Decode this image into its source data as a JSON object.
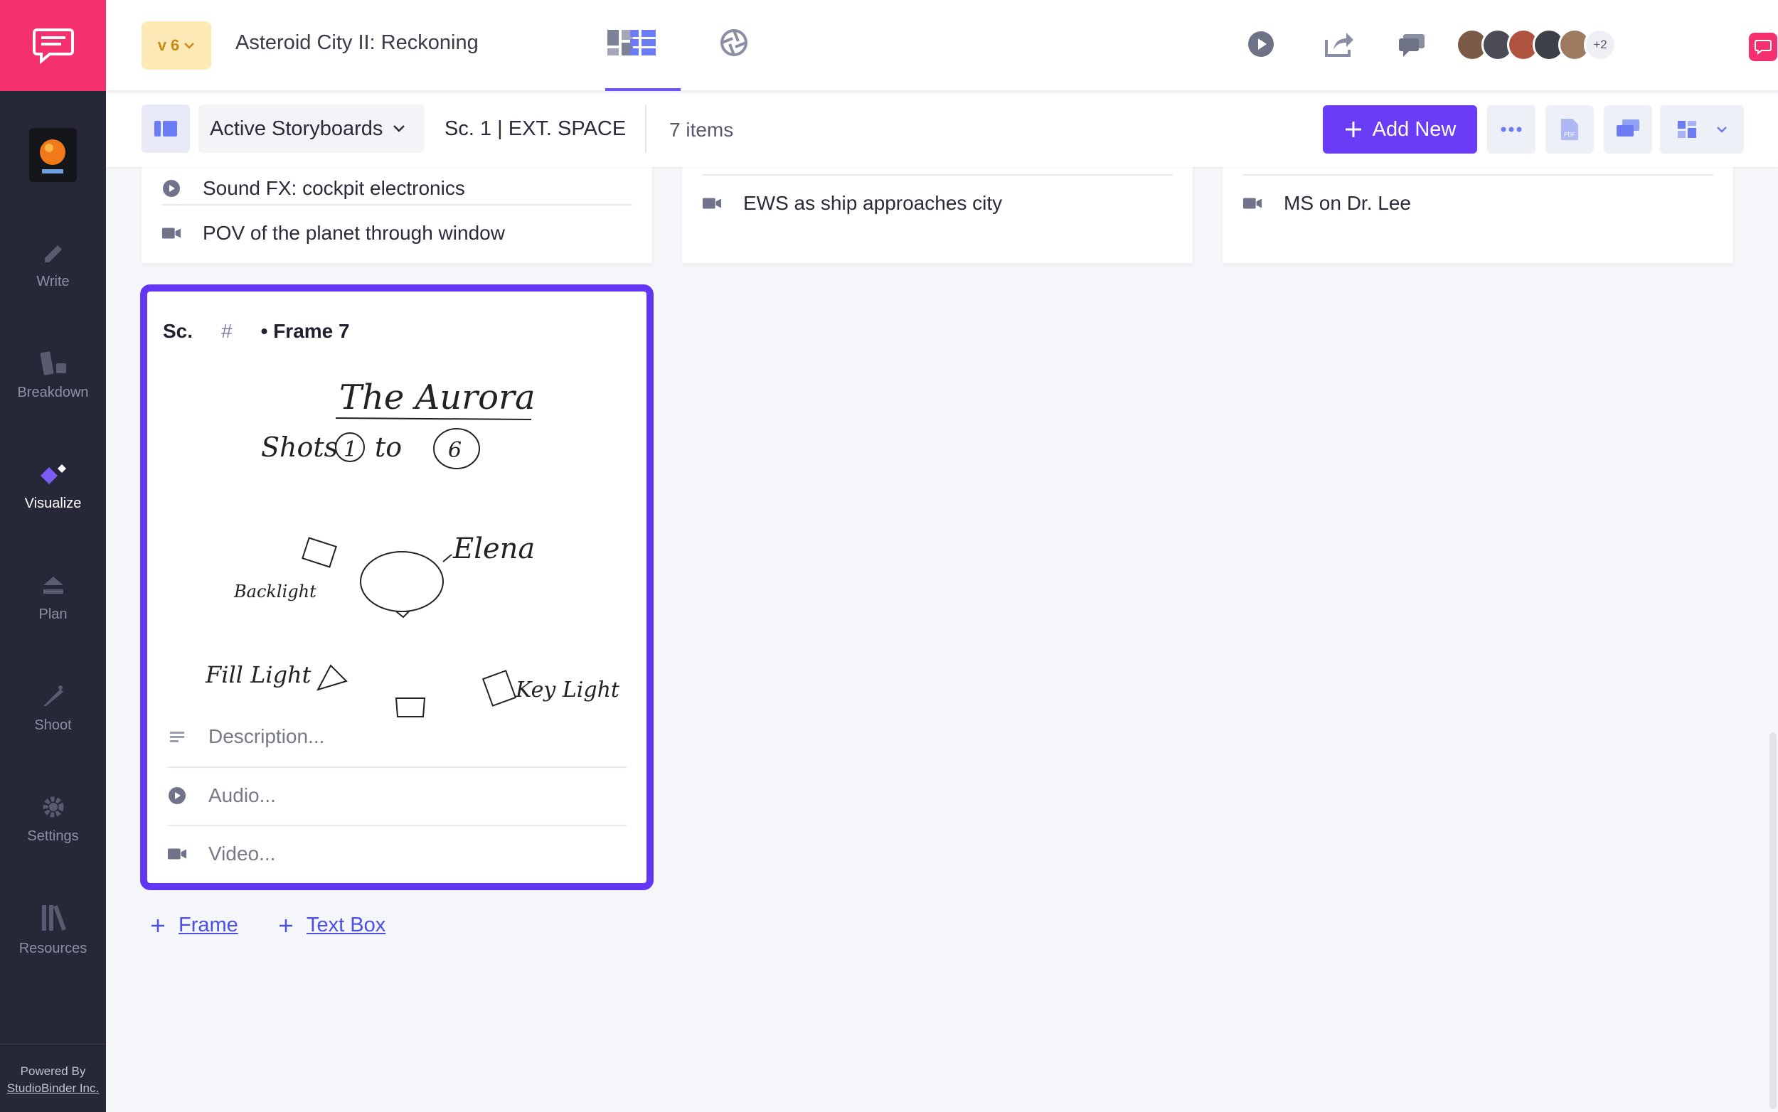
{
  "sidebar": {
    "nav": [
      {
        "id": "write",
        "label": "Write",
        "icon": "pencil-icon"
      },
      {
        "id": "breakdown",
        "label": "Breakdown",
        "icon": "breakdown-icon"
      },
      {
        "id": "visualize",
        "label": "Visualize",
        "icon": "visualize-icon",
        "active": true
      },
      {
        "id": "plan",
        "label": "Plan",
        "icon": "plan-icon"
      },
      {
        "id": "shoot",
        "label": "Shoot",
        "icon": "shoot-icon"
      },
      {
        "id": "settings",
        "label": "Settings",
        "icon": "gear-icon"
      },
      {
        "id": "resources",
        "label": "Resources",
        "icon": "books-icon"
      }
    ],
    "powered_by": "Powered By",
    "company": "StudioBinder Inc."
  },
  "topbar": {
    "version": "v 6",
    "project_title": "Asteroid City II: Reckoning",
    "avatars_more": "+2"
  },
  "subbar": {
    "storyboard_select": "Active Storyboards",
    "scene": "Sc. 1 | EXT. SPACE",
    "item_count": "7 items",
    "add_new": "Add New"
  },
  "cards": [
    {
      "rows": [
        "Sound FX: cockpit electronics",
        "POV of the planet through window"
      ]
    },
    {
      "rows": [
        "EWS as ship approaches city"
      ]
    },
    {
      "rows": [
        "MS on Dr. Lee"
      ]
    }
  ],
  "frame": {
    "sc": "Sc.",
    "hash": "#",
    "title": "• Frame  7",
    "sketch_text": {
      "title": "The Aurora",
      "shots": "Shots",
      "shot_from": "1",
      "shot_to_word": "to",
      "shot_to": "6",
      "backlight": "Backlight",
      "elena": "Elena",
      "fill_light": "Fill Light",
      "key_light": "Key Light"
    },
    "description_ph": "Description...",
    "audio_ph": "Audio...",
    "video_ph": "Video..."
  },
  "add_frame": "Frame",
  "add_textbox": "Text Box",
  "colors": {
    "accent": "#6236f2",
    "brand": "#f4306f",
    "sidebar": "#262837",
    "link": "#4b4fe6"
  }
}
